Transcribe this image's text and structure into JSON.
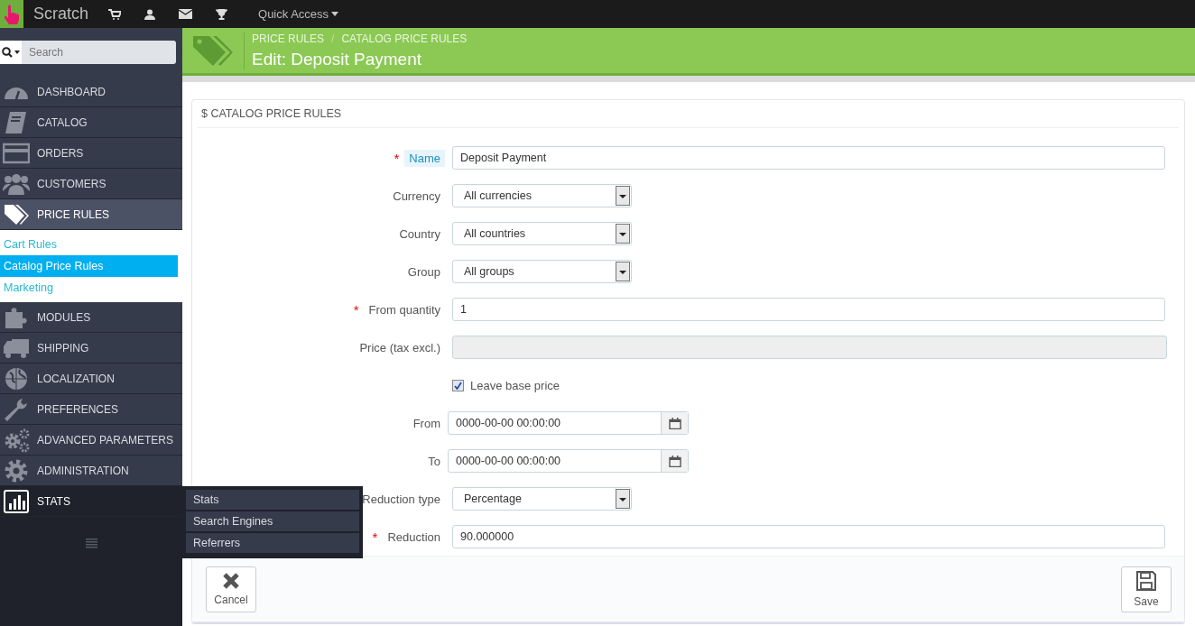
{
  "topbar": {
    "shop_name": "Scratch",
    "quick_access": "Quick Access"
  },
  "sidebar": {
    "search": {
      "placeholder": "Search"
    },
    "menu": [
      {
        "label": "DASHBOARD",
        "selected": false,
        "hovered": false
      },
      {
        "label": "CATALOG",
        "selected": false,
        "hovered": false
      },
      {
        "label": "ORDERS",
        "selected": false,
        "hovered": false
      },
      {
        "label": "CUSTOMERS",
        "selected": false,
        "hovered": false
      },
      {
        "label": "PRICE RULES",
        "selected": true,
        "hovered": false,
        "expanded": true,
        "children": [
          {
            "label": "Cart Rules",
            "selected": false
          },
          {
            "label": "Catalog Price Rules",
            "selected": true
          },
          {
            "label": "Marketing",
            "selected": false
          }
        ]
      },
      {
        "label": "MODULES",
        "selected": false,
        "hovered": false
      },
      {
        "label": "SHIPPING",
        "selected": false,
        "hovered": false
      },
      {
        "label": "LOCALIZATION",
        "selected": false,
        "hovered": false
      },
      {
        "label": "PREFERENCES",
        "selected": false,
        "hovered": false
      },
      {
        "label": "ADVANCED PARAMETERS",
        "selected": false,
        "hovered": false
      },
      {
        "label": "ADMINISTRATION",
        "selected": false,
        "hovered": false
      },
      {
        "label": "STATS",
        "selected": false,
        "hovered": true,
        "expanded": false,
        "children": [
          {
            "label": "Stats",
            "selected": false
          },
          {
            "label": "Search Engines",
            "selected": false
          },
          {
            "label": "Referrers",
            "selected": false
          }
        ]
      }
    ]
  },
  "header": {
    "breadcrumb": [
      "PRICE RULES",
      "CATALOG PRICE RULES"
    ],
    "separator": "/",
    "title": "Edit: Deposit Payment"
  },
  "panel": {
    "heading": "$ CATALOG PRICE RULES",
    "fields": [
      {
        "kind": "text",
        "label": "Name",
        "marker": "*",
        "help": true,
        "value": "Deposit Payment"
      },
      {
        "kind": "select",
        "label": "Currency",
        "help": false,
        "value": "All currencies"
      },
      {
        "kind": "select",
        "label": "Country",
        "help": false,
        "value": "All countries"
      },
      {
        "kind": "select",
        "label": "Group",
        "help": false,
        "value": "All groups"
      },
      {
        "kind": "text",
        "label": "From quantity",
        "marker": "*",
        "help": false,
        "value": "1"
      },
      {
        "kind": "disabled",
        "label": "Price (tax excl.)",
        "help": false
      },
      {
        "kind": "checkbox",
        "label": "Leave base price",
        "checked": true
      },
      {
        "kind": "date",
        "label": "From",
        "help": false,
        "value": "0000-00-00 00:00:00"
      },
      {
        "kind": "date",
        "label": "To",
        "help": false,
        "value": "0000-00-00 00:00:00"
      },
      {
        "kind": "select",
        "label": "Reduction type",
        "help": false,
        "value": "Percentage"
      },
      {
        "kind": "text",
        "label": "Reduction",
        "marker": "*",
        "help": false,
        "value": "90.000000"
      }
    ],
    "buttons": [
      {
        "kind": "cancel",
        "label": "Cancel"
      },
      {
        "kind": "save",
        "label": "Save"
      }
    ]
  }
}
